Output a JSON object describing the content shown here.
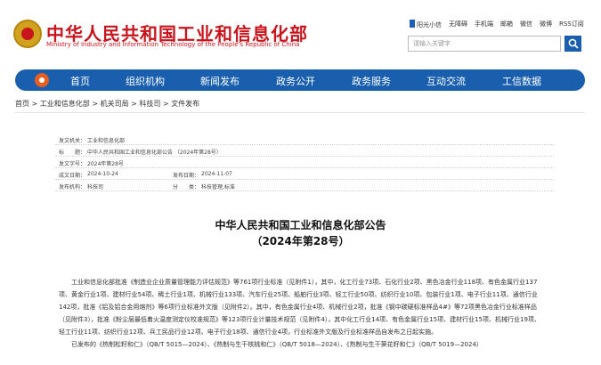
{
  "header": {
    "site_name_cn": "中华人民共和国工业和信息化部",
    "site_name_en": "Ministry of Industry and Information Technology of the People's Republic of China",
    "top_links": [
      "阳光小信",
      "无障碍",
      "手机端",
      "邮箱",
      "微信",
      "微博",
      "RSS订阅"
    ],
    "search_placeholder": "请输入关键字"
  },
  "nav": {
    "items": [
      "首页",
      "组织机构",
      "新闻发布",
      "政务公开",
      "政务服务",
      "互动交流",
      "工信数据"
    ]
  },
  "breadcrumb": [
    "首页",
    "工业和信息化部",
    "机关司局",
    "科技司",
    "文件发布"
  ],
  "info": {
    "issuer_label": "发文机关：",
    "issuer": "工业和信息化部",
    "title_label": "标　　题：",
    "title": "中华人民共和国工业和信息化部公告 （2024年第28号）",
    "doc_no_label": "发文字号：",
    "doc_no": "2024年第28号",
    "created_label": "成文日期：",
    "created": "2024-10-24",
    "published_label": "发布日期：",
    "published": "2024-11-07",
    "org_label": "发布机构：",
    "org": "科技司",
    "category_label": "分　　类：",
    "category": "科技管理,标准"
  },
  "announcement": {
    "title": "中华人民共和国工业和信息化部公告",
    "subtitle": "（2024年第28号）",
    "paragraph1": "工业和信息化部批准《制造业企业质量管理能力评估规范》等761项行业标准（见附件1），其中，化工行业73项、石化行业2项、黑色冶金行业118项、有色金属行业137项、黄金行业1项、建材行业54项、稀土行业1项、机械行业133项、汽车行业25项、船舶行业3项、轻工行业50项、纺织行业10项、包装行业1项、电子行业11项、通信行业142项，批准《铝及铝合金用熔剂》等6项行业标准外文版（见附件2）。其中，有色金属行业4项、机械行业2项，批准《钢中碳硬标准样品4#》等72项黑色冶金行业标准样品（见附件3），批准《粉尘层最低着火温度测定仪校准规范》等123项行业计量技术规范（见附件4），其中化工行业14项、有色金属行业15项、建材行业15项、机械行业19项、轻工行业11项、纺织行业12项、兵工民品行业12项、电子行业18项、通信行业4项，行业标准外文版及行业标准样品自发布之日起实施。",
    "paragraph2": "已发布的《热制松籽和仁》（QB/T 5015—2024）、《热制与生干核桃和仁》（QB/T 5018—2024）、《热制与生干葵花籽和仁》（QB/T 5019—2024）"
  }
}
